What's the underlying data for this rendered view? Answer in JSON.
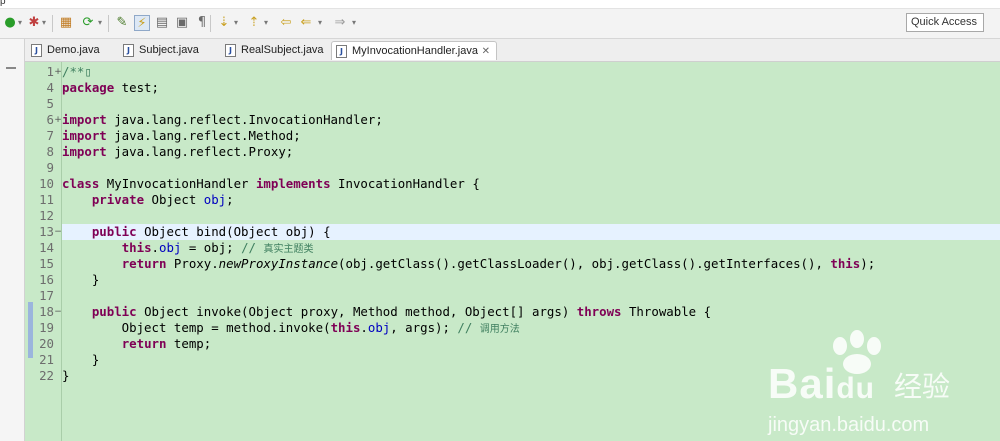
{
  "window": {
    "menu_fragment": "p"
  },
  "toolbar": {
    "quick_access_label": "Quick Access",
    "icons": [
      "run-icon",
      "debug-icon",
      "external-tools-icon",
      "new-java-project-icon",
      "open-type-icon",
      "toggle-mark-occurrences-icon",
      "toggle-block-selection-icon",
      "show-whitespace-icon",
      "next-annotation-icon",
      "previous-annotation-icon",
      "last-edit-location-icon",
      "back-icon",
      "forward-icon"
    ]
  },
  "tabs": [
    {
      "label": "Demo.java"
    },
    {
      "label": "Subject.java"
    },
    {
      "label": "RealSubject.java"
    },
    {
      "label": "MyInvocationHandler.java",
      "active": true,
      "close": "✕"
    }
  ],
  "editor": {
    "lines": [
      {
        "n": "1",
        "fold": "+",
        "segments": [
          {
            "t": "/**",
            "c": "comment"
          },
          {
            "t": "▯",
            "c": "comment"
          }
        ]
      },
      {
        "n": "4",
        "segments": [
          {
            "t": "package",
            "c": "kw"
          },
          {
            "t": " test;"
          }
        ]
      },
      {
        "n": "5",
        "segments": []
      },
      {
        "n": "6",
        "fold": "+",
        "segments": [
          {
            "t": "import",
            "c": "kw"
          },
          {
            "t": " java.lang.reflect.InvocationHandler;"
          }
        ]
      },
      {
        "n": "7",
        "segments": [
          {
            "t": "import",
            "c": "kw"
          },
          {
            "t": " java.lang.reflect.Method;"
          }
        ]
      },
      {
        "n": "8",
        "segments": [
          {
            "t": "import",
            "c": "kw"
          },
          {
            "t": " java.lang.reflect.Proxy;"
          }
        ]
      },
      {
        "n": "9",
        "segments": []
      },
      {
        "n": "10",
        "segments": [
          {
            "t": "class",
            "c": "kw"
          },
          {
            "t": " MyInvocationHandler "
          },
          {
            "t": "implements",
            "c": "kw"
          },
          {
            "t": " InvocationHandler {"
          }
        ]
      },
      {
        "n": "11",
        "segments": [
          {
            "t": "    "
          },
          {
            "t": "private",
            "c": "kw"
          },
          {
            "t": " Object "
          },
          {
            "t": "obj",
            "c": "field"
          },
          {
            "t": ";"
          }
        ]
      },
      {
        "n": "12",
        "segments": []
      },
      {
        "n": "13",
        "fold": "−",
        "current": true,
        "segments": [
          {
            "t": "    "
          },
          {
            "t": "public",
            "c": "kw"
          },
          {
            "t": " Object bind(Object obj) {"
          }
        ]
      },
      {
        "n": "14",
        "segments": [
          {
            "t": "        "
          },
          {
            "t": "this",
            "c": "kw"
          },
          {
            "t": "."
          },
          {
            "t": "obj",
            "c": "field"
          },
          {
            "t": " = obj; "
          },
          {
            "t": "// ",
            "c": "comment"
          },
          {
            "t": "真实主题类",
            "c": "comment cjk"
          }
        ]
      },
      {
        "n": "15",
        "segments": [
          {
            "t": "        "
          },
          {
            "t": "return",
            "c": "kw"
          },
          {
            "t": " Proxy."
          },
          {
            "t": "newProxyInstance",
            "c": "italic"
          },
          {
            "t": "(obj.getClass().getClassLoader(), obj.getClass().getInterfaces(), "
          },
          {
            "t": "this",
            "c": "kw"
          },
          {
            "t": ");"
          }
        ]
      },
      {
        "n": "16",
        "segments": [
          {
            "t": "    }"
          }
        ]
      },
      {
        "n": "17",
        "segments": []
      },
      {
        "n": "18",
        "fold": "−",
        "segments": [
          {
            "t": "    "
          },
          {
            "t": "public",
            "c": "kw"
          },
          {
            "t": " Object invoke(Object proxy, Method method, Object[] args) "
          },
          {
            "t": "throws",
            "c": "kw"
          },
          {
            "t": " Throwable {"
          }
        ]
      },
      {
        "n": "19",
        "segments": [
          {
            "t": "        Object temp = method.invoke("
          },
          {
            "t": "this",
            "c": "kw"
          },
          {
            "t": "."
          },
          {
            "t": "obj",
            "c": "field"
          },
          {
            "t": ", args); "
          },
          {
            "t": "// ",
            "c": "comment"
          },
          {
            "t": "调用方法",
            "c": "comment cjk"
          }
        ]
      },
      {
        "n": "20",
        "segments": [
          {
            "t": "        "
          },
          {
            "t": "return",
            "c": "kw"
          },
          {
            "t": " temp;"
          }
        ]
      },
      {
        "n": "21",
        "segments": [
          {
            "t": "    }"
          }
        ]
      },
      {
        "n": "22",
        "segments": [
          {
            "t": "}"
          }
        ]
      }
    ]
  },
  "watermark": {
    "brand": "Bai",
    "brand_du": "du",
    "jingyan": "经验",
    "url": "jingyan.baidu.com"
  }
}
